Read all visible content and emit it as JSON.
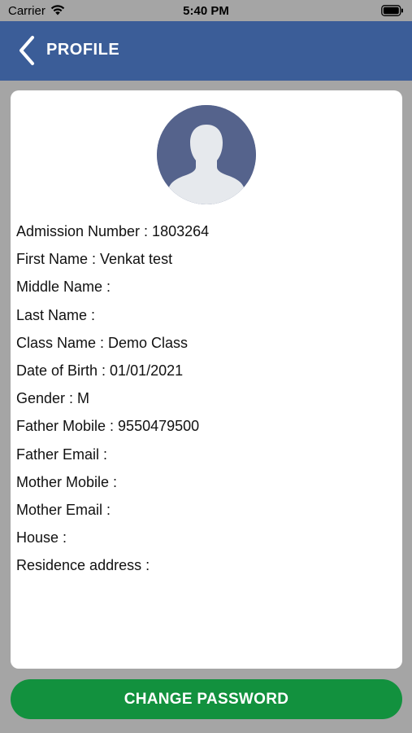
{
  "status_bar": {
    "carrier": "Carrier",
    "time": "5:40 PM"
  },
  "nav": {
    "title": "PROFILE",
    "back_icon": "chevron-left-icon"
  },
  "avatar": {
    "icon": "user-avatar-icon"
  },
  "profile": {
    "fields": [
      {
        "label": "Admission Number",
        "value": "1803264",
        "text": "Admission Number : 1803264"
      },
      {
        "label": "First Name",
        "value": "Venkat test",
        "text": "First Name : Venkat test"
      },
      {
        "label": "Middle Name",
        "value": "",
        "text": "Middle Name :"
      },
      {
        "label": "Last Name",
        "value": "",
        "text": "Last Name :"
      },
      {
        "label": "Class Name",
        "value": "Demo Class",
        "text": "Class Name : Demo Class"
      },
      {
        "label": "Date of Birth",
        "value": "01/01/2021",
        "text": "Date of Birth : 01/01/2021"
      },
      {
        "label": "Gender",
        "value": "M",
        "text": "Gender : M"
      },
      {
        "label": "Father Mobile",
        "value": "9550479500",
        "text": "Father Mobile : 9550479500"
      },
      {
        "label": "Father Email",
        "value": "",
        "text": "Father Email :"
      },
      {
        "label": "Mother Mobile",
        "value": "",
        "text": "Mother Mobile :"
      },
      {
        "label": "Mother Email",
        "value": "",
        "text": "Mother Email :"
      },
      {
        "label": "House",
        "value": "",
        "text": "House :"
      },
      {
        "label": "Residence address",
        "value": "",
        "text": "Residence address :"
      }
    ]
  },
  "actions": {
    "change_password": "CHANGE PASSWORD"
  },
  "colors": {
    "nav_background": "#3b5d98",
    "page_background": "#a5a5a5",
    "button_green": "#12913e",
    "avatar_background": "#55638c"
  }
}
